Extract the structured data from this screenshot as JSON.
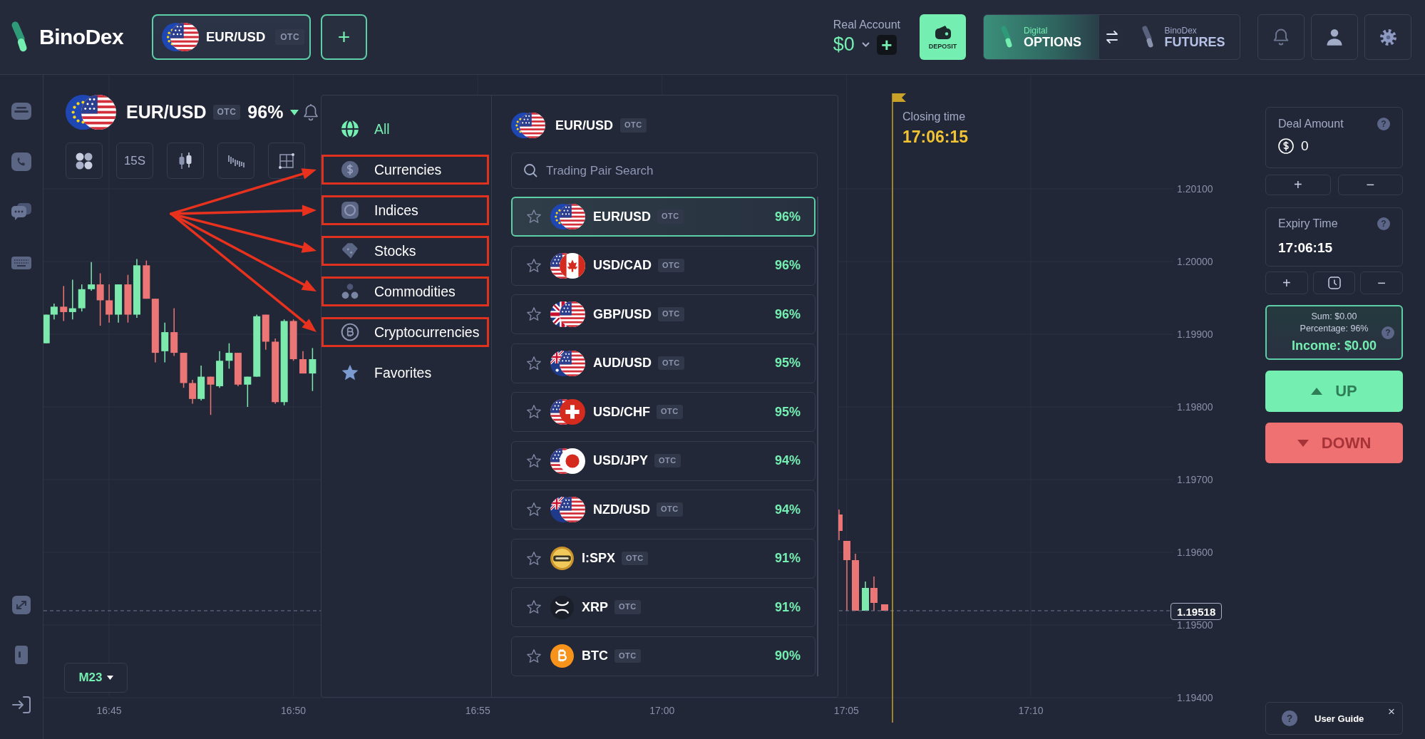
{
  "header": {
    "logo": "BinoDex",
    "active_pair": {
      "name": "EUR/USD",
      "badge": "OTC"
    },
    "add_tab": "+",
    "account": {
      "label": "Real Account",
      "balance": "$0",
      "top_up": "+"
    },
    "deposit": "DEPOSIT",
    "platforms": [
      {
        "caption": "Digital",
        "label": "OPTIONS",
        "selected": true
      },
      {
        "caption": "BinoDex",
        "label": "FUTURES",
        "selected": false
      }
    ]
  },
  "chart": {
    "pair": {
      "name": "EUR/USD",
      "badge": "OTC",
      "payout": "96%"
    },
    "timeframe": "15S",
    "closing_time": {
      "label": "Closing time",
      "value": "17:06:15"
    },
    "price_axis": [
      "1.20100",
      "1.20000",
      "1.19900",
      "1.19800",
      "1.19700",
      "1.19600",
      "1.19500",
      "1.19400"
    ],
    "current_price": "1.19518",
    "time_axis": [
      "16:45",
      "16:50",
      "16:55",
      "17:00",
      "17:05",
      "17:10"
    ],
    "interval": "M23"
  },
  "asset_menu": {
    "categories": [
      {
        "label": "All",
        "selected": true,
        "highlighted": false
      },
      {
        "label": "Currencies",
        "selected": false,
        "highlighted": true
      },
      {
        "label": "Indices",
        "selected": false,
        "highlighted": true
      },
      {
        "label": "Stocks",
        "selected": false,
        "highlighted": true
      },
      {
        "label": "Commodities",
        "selected": false,
        "highlighted": true
      },
      {
        "label": "Cryptocurrencies",
        "selected": false,
        "highlighted": true
      },
      {
        "label": "Favorites",
        "selected": false,
        "highlighted": false
      }
    ],
    "current": {
      "name": "EUR/USD",
      "badge": "OTC"
    },
    "search": {
      "placeholder": "Trading Pair Search"
    },
    "assets": [
      {
        "name": "EUR/USD",
        "badge": "OTC",
        "payout": "96%",
        "selected": true,
        "favorite": false
      },
      {
        "name": "USD/CAD",
        "badge": "OTC",
        "payout": "96%",
        "selected": false,
        "favorite": false
      },
      {
        "name": "GBP/USD",
        "badge": "OTC",
        "payout": "96%",
        "selected": false,
        "favorite": false
      },
      {
        "name": "AUD/USD",
        "badge": "OTC",
        "payout": "95%",
        "selected": false,
        "favorite": false
      },
      {
        "name": "USD/CHF",
        "badge": "OTC",
        "payout": "95%",
        "selected": false,
        "favorite": false
      },
      {
        "name": "USD/JPY",
        "badge": "OTC",
        "payout": "94%",
        "selected": false,
        "favorite": false
      },
      {
        "name": "NZD/USD",
        "badge": "OTC",
        "payout": "94%",
        "selected": false,
        "favorite": false
      },
      {
        "name": "I:SPX",
        "badge": "OTC",
        "payout": "91%",
        "selected": false,
        "favorite": false
      },
      {
        "name": "XRP",
        "badge": "OTC",
        "payout": "91%",
        "selected": false,
        "favorite": false
      },
      {
        "name": "BTC",
        "badge": "OTC",
        "payout": "90%",
        "selected": false,
        "favorite": false
      }
    ]
  },
  "trade_panel": {
    "deal_amount": {
      "label": "Deal Amount",
      "help": "?",
      "value": "0",
      "steps": [
        "+",
        "−"
      ]
    },
    "expiry_time": {
      "label": "Expiry Time",
      "help": "?",
      "value": "17:06:15",
      "steps": [
        "+",
        "−"
      ]
    },
    "summary": {
      "sum": "Sum: $0.00",
      "percentage": "Percentage: 96%",
      "income": "Income: $0.00",
      "help": "?"
    },
    "up": "UP",
    "down": "DOWN",
    "user_guide": {
      "help": "?",
      "label": "User Guide",
      "close": "×"
    }
  }
}
